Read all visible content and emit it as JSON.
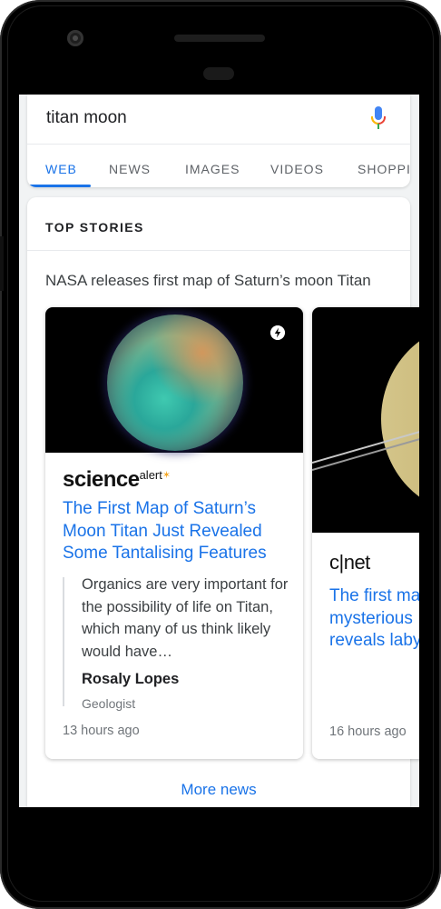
{
  "search": {
    "query": "titan moon",
    "mic_icon": "mic-icon"
  },
  "tabs": [
    {
      "label": "WEB",
      "active": true
    },
    {
      "label": "NEWS",
      "active": false
    },
    {
      "label": "IMAGES",
      "active": false
    },
    {
      "label": "VIDEOS",
      "active": false
    },
    {
      "label": "SHOPPI",
      "active": false
    }
  ],
  "top_stories": {
    "title": "TOP STORIES",
    "headline": "NASA releases first map of Saturn’s moon Titan",
    "cards": [
      {
        "source": "science",
        "source_suffix": "alert",
        "amp_icon": "amp-lightning-icon",
        "title": "The First Map of Saturn’s Moon Titan Just Revealed Some Tantalising Features",
        "quote": "Organics are very important for the possibility of life on Titan, which many of us think likely would have…",
        "quote_author": "Rosaly Lopes",
        "quote_role": "Geologist",
        "time": "13 hours ago"
      },
      {
        "source": "c|net",
        "title_lines": [
          "The first ma",
          "mysterious",
          "reveals laby"
        ],
        "time": "16 hours ago"
      }
    ],
    "more_label": "More news"
  },
  "colors": {
    "accent": "#1a73e8",
    "text": "#202124",
    "muted": "#70757a",
    "background": "#f1f3f4"
  }
}
